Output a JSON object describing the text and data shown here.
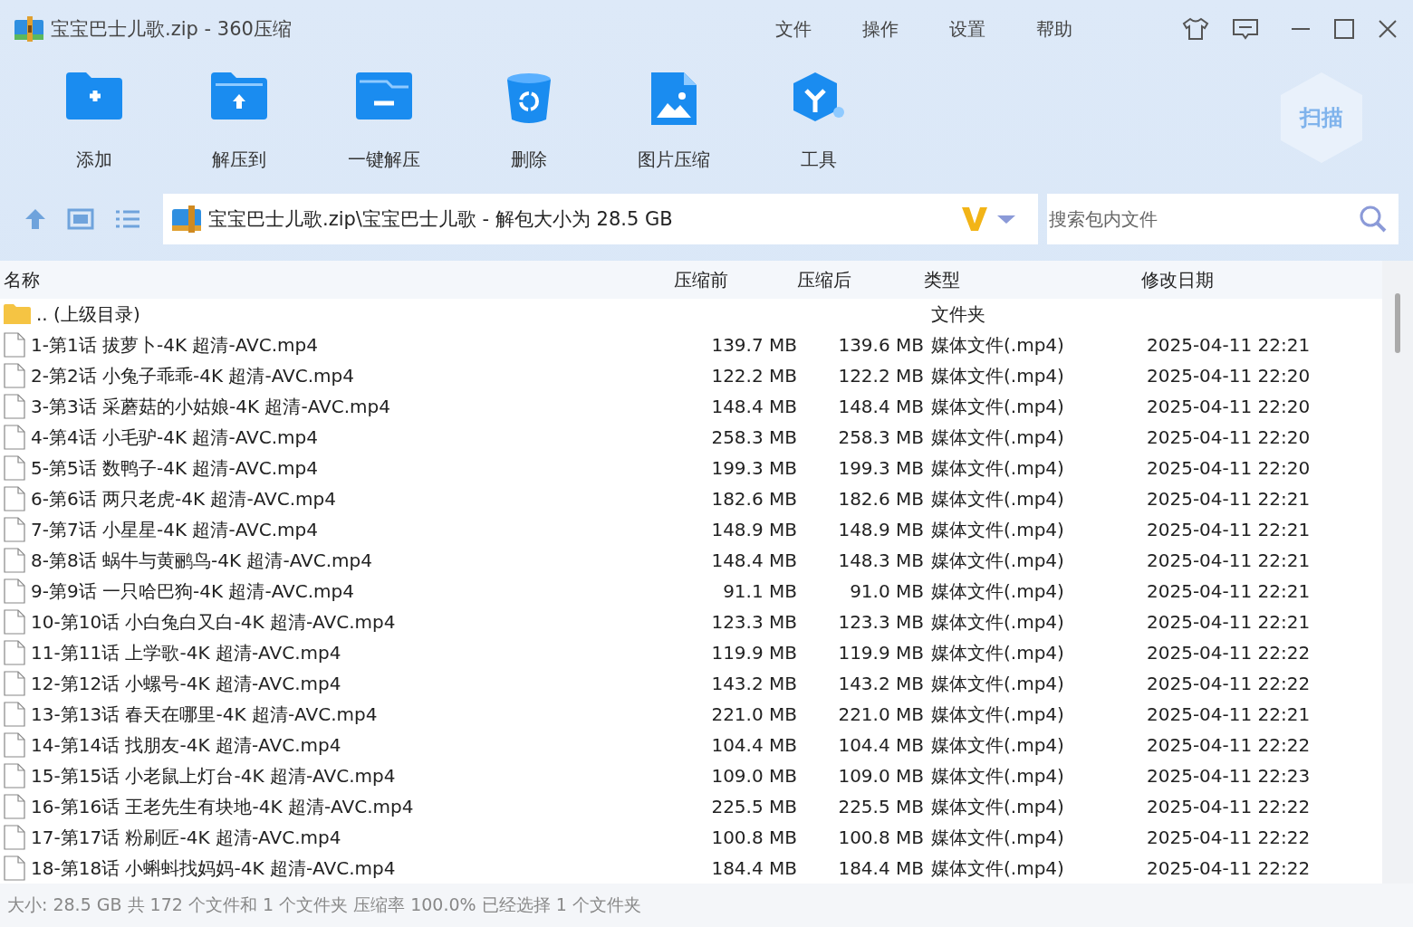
{
  "window": {
    "title": "宝宝巴士儿歌.zip - 360压缩"
  },
  "menu": [
    "文件",
    "操作",
    "设置",
    "帮助"
  ],
  "toolbar": [
    {
      "kind": "add",
      "label": "添加"
    },
    {
      "kind": "extract",
      "label": "解压到"
    },
    {
      "kind": "oneclick",
      "label": "一键解压"
    },
    {
      "kind": "delete",
      "label": "删除"
    },
    {
      "kind": "image",
      "label": "图片压缩"
    },
    {
      "kind": "tools",
      "label": "工具"
    }
  ],
  "scan_badge": "扫描",
  "address": {
    "path": "宝宝巴士儿歌.zip\\宝宝巴士儿歌 - 解包大小为 28.5 GB"
  },
  "search": {
    "placeholder": "搜索包内文件"
  },
  "table": {
    "columns": [
      "名称",
      "压缩前",
      "压缩后",
      "类型",
      "修改日期"
    ],
    "rows": [
      {
        "kind": "folder",
        "name": ".. (上级目录)",
        "before": "",
        "after": "",
        "type": "文件夹",
        "date": ""
      },
      {
        "kind": "file",
        "name": "1-第1话 拔萝卜-4K 超清-AVC.mp4",
        "before": "139.7 MB",
        "after": "139.6 MB",
        "type": "媒体文件(.mp4)",
        "date": "2025-04-11 22:21"
      },
      {
        "kind": "file",
        "name": "2-第2话 小兔子乖乖-4K 超清-AVC.mp4",
        "before": "122.2 MB",
        "after": "122.2 MB",
        "type": "媒体文件(.mp4)",
        "date": "2025-04-11 22:20"
      },
      {
        "kind": "file",
        "name": "3-第3话 采蘑菇的小姑娘-4K 超清-AVC.mp4",
        "before": "148.4 MB",
        "after": "148.4 MB",
        "type": "媒体文件(.mp4)",
        "date": "2025-04-11 22:20"
      },
      {
        "kind": "file",
        "name": "4-第4话 小毛驴-4K 超清-AVC.mp4",
        "before": "258.3 MB",
        "after": "258.3 MB",
        "type": "媒体文件(.mp4)",
        "date": "2025-04-11 22:20"
      },
      {
        "kind": "file",
        "name": "5-第5话 数鸭子-4K 超清-AVC.mp4",
        "before": "199.3 MB",
        "after": "199.3 MB",
        "type": "媒体文件(.mp4)",
        "date": "2025-04-11 22:20"
      },
      {
        "kind": "file",
        "name": "6-第6话 两只老虎-4K 超清-AVC.mp4",
        "before": "182.6 MB",
        "after": "182.6 MB",
        "type": "媒体文件(.mp4)",
        "date": "2025-04-11 22:21"
      },
      {
        "kind": "file",
        "name": "7-第7话 小星星-4K 超清-AVC.mp4",
        "before": "148.9 MB",
        "after": "148.9 MB",
        "type": "媒体文件(.mp4)",
        "date": "2025-04-11 22:21"
      },
      {
        "kind": "file",
        "name": "8-第8话 蜗牛与黄鹂鸟-4K 超清-AVC.mp4",
        "before": "148.4 MB",
        "after": "148.3 MB",
        "type": "媒体文件(.mp4)",
        "date": "2025-04-11 22:21"
      },
      {
        "kind": "file",
        "name": "9-第9话 一只哈巴狗-4K 超清-AVC.mp4",
        "before": "91.1 MB",
        "after": "91.0 MB",
        "type": "媒体文件(.mp4)",
        "date": "2025-04-11 22:21"
      },
      {
        "kind": "file",
        "name": "10-第10话 小白兔白又白-4K 超清-AVC.mp4",
        "before": "123.3 MB",
        "after": "123.3 MB",
        "type": "媒体文件(.mp4)",
        "date": "2025-04-11 22:21"
      },
      {
        "kind": "file",
        "name": "11-第11话 上学歌-4K 超清-AVC.mp4",
        "before": "119.9 MB",
        "after": "119.9 MB",
        "type": "媒体文件(.mp4)",
        "date": "2025-04-11 22:22"
      },
      {
        "kind": "file",
        "name": "12-第12话 小螺号-4K 超清-AVC.mp4",
        "before": "143.2 MB",
        "after": "143.2 MB",
        "type": "媒体文件(.mp4)",
        "date": "2025-04-11 22:22"
      },
      {
        "kind": "file",
        "name": "13-第13话 春天在哪里-4K 超清-AVC.mp4",
        "before": "221.0 MB",
        "after": "221.0 MB",
        "type": "媒体文件(.mp4)",
        "date": "2025-04-11 22:21"
      },
      {
        "kind": "file",
        "name": "14-第14话 找朋友-4K 超清-AVC.mp4",
        "before": "104.4 MB",
        "after": "104.4 MB",
        "type": "媒体文件(.mp4)",
        "date": "2025-04-11 22:22"
      },
      {
        "kind": "file",
        "name": "15-第15话 小老鼠上灯台-4K 超清-AVC.mp4",
        "before": "109.0 MB",
        "after": "109.0 MB",
        "type": "媒体文件(.mp4)",
        "date": "2025-04-11 22:23"
      },
      {
        "kind": "file",
        "name": "16-第16话 王老先生有块地-4K 超清-AVC.mp4",
        "before": "225.5 MB",
        "after": "225.5 MB",
        "type": "媒体文件(.mp4)",
        "date": "2025-04-11 22:22"
      },
      {
        "kind": "file",
        "name": "17-第17话 粉刷匠-4K 超清-AVC.mp4",
        "before": "100.8 MB",
        "after": "100.8 MB",
        "type": "媒体文件(.mp4)",
        "date": "2025-04-11 22:22"
      },
      {
        "kind": "file",
        "name": "18-第18话 小蝌蚪找妈妈-4K 超清-AVC.mp4",
        "before": "184.4 MB",
        "after": "184.4 MB",
        "type": "媒体文件(.mp4)",
        "date": "2025-04-11 22:22"
      }
    ]
  },
  "status_bar": "大小: 28.5 GB 共 172 个文件和 1 个文件夹 压缩率 100.0% 已经选择 1 个文件夹"
}
